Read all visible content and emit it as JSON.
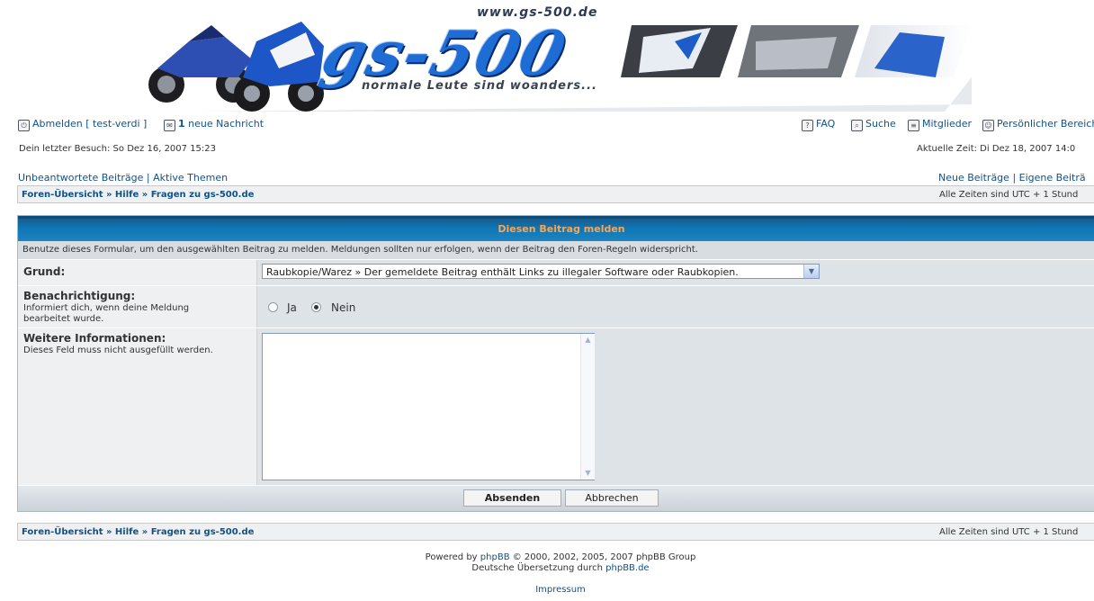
{
  "header": {
    "url": "www.gs-500.de",
    "logo": "gs-500",
    "slogan": "normale Leute sind woanders..."
  },
  "nav": {
    "logout": "Abmelden [ test-verdi ]",
    "messages_count": "1",
    "messages_label": "neue Nachricht",
    "faq": "FAQ",
    "search": "Suche",
    "members": "Mitglieder",
    "profile": "Persönlicher Bereich"
  },
  "info": {
    "last_visit": "Dein letzter Besuch: So Dez 16, 2007 15:23",
    "current_time": "Aktuelle Zeit: Di Dez 18, 2007 14:0"
  },
  "quicklinks": {
    "unanswered": "Unbeantwortete Beiträge",
    "sep": "|",
    "active": "Aktive Themen",
    "new_posts": "Neue Beiträge",
    "own_posts": "Eigene Beiträ"
  },
  "breadcrumb": {
    "index": "Foren-Übersicht",
    "sep": "»",
    "help": "Hilfe",
    "faq": "Fragen zu gs-500.de",
    "timezone": "Alle Zeiten sind UTC + 1 Stund"
  },
  "form": {
    "title": "Diesen Beitrag melden",
    "description": "Benutze dieses Formular, um den ausgewählten Beitrag zu melden. Meldungen sollten nur erfolgen, wenn der Beitrag den Foren-Regeln widerspricht.",
    "reason_label": "Grund:",
    "reason_value": "Raubkopie/Warez » Der gemeldete Beitrag enthält Links zu illegaler Software oder Raubkopien.",
    "notify_label": "Benachrichtigung:",
    "notify_desc": "Informiert dich, wenn deine Meldung bearbeitet wurde.",
    "notify_yes": "Ja",
    "notify_no": "Nein",
    "notify_selected": "Nein",
    "info_label": "Weitere Informationen:",
    "info_desc": "Dieses Feld muss nicht ausgefüllt werden.",
    "info_value": "",
    "submit": "Absenden",
    "cancel": "Abbrechen"
  },
  "footer": {
    "powered_prefix": "Powered by",
    "powered_link": "phpBB",
    "powered_suffix": "© 2000, 2002, 2005, 2007 phpBB Group",
    "translation_prefix": "Deutsche Übersetzung durch",
    "translation_link": "phpBB.de",
    "impressum": "Impressum"
  },
  "colors": {
    "link": "#105289",
    "form_header": "#0d76b4",
    "form_title": "#ffa34f"
  }
}
